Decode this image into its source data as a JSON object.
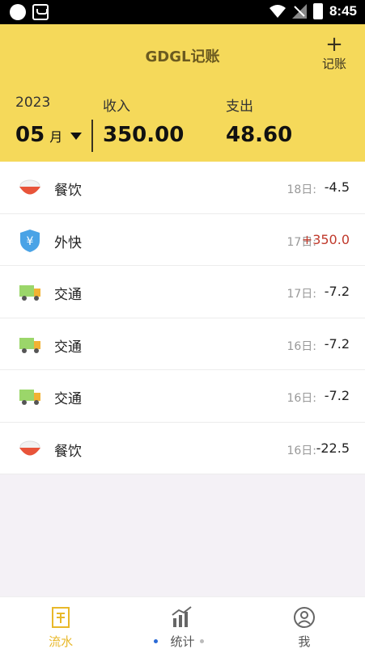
{
  "status_bar": {
    "time": "8:45"
  },
  "header": {
    "title": "GDGL记账",
    "add_label": "记账",
    "add_symbol": "+",
    "year": "2023",
    "month": "05",
    "month_unit": "月",
    "income_label": "收入",
    "income_value": "350.00",
    "expense_label": "支出",
    "expense_value": "48.60",
    "color": "#f5d95a"
  },
  "records": [
    {
      "icon": "rice-bowl-icon",
      "category": "餐饮",
      "day": "18日:",
      "amount": "-4.5",
      "type": "expense"
    },
    {
      "icon": "yuan-shield-icon",
      "category": "外快",
      "day": "17日:",
      "amount": "+350.0",
      "type": "income"
    },
    {
      "icon": "truck-icon",
      "category": "交通",
      "day": "17日:",
      "amount": "-7.2",
      "type": "expense"
    },
    {
      "icon": "truck-icon",
      "category": "交通",
      "day": "16日:",
      "amount": "-7.2",
      "type": "expense"
    },
    {
      "icon": "truck-icon",
      "category": "交通",
      "day": "16日:",
      "amount": "-7.2",
      "type": "expense"
    },
    {
      "icon": "rice-bowl-icon",
      "category": "餐饮",
      "day": "16日:",
      "amount": "-22.5",
      "type": "expense"
    }
  ],
  "tabs": [
    {
      "label": "流水",
      "icon": "ledger-icon",
      "active": true
    },
    {
      "label": "统计",
      "icon": "chart-icon",
      "active": false
    },
    {
      "label": "我",
      "icon": "profile-icon",
      "active": false
    }
  ],
  "colors": {
    "accent": "#f5d95a",
    "income": "#c0392b",
    "active_tab": "#e8b82a"
  }
}
